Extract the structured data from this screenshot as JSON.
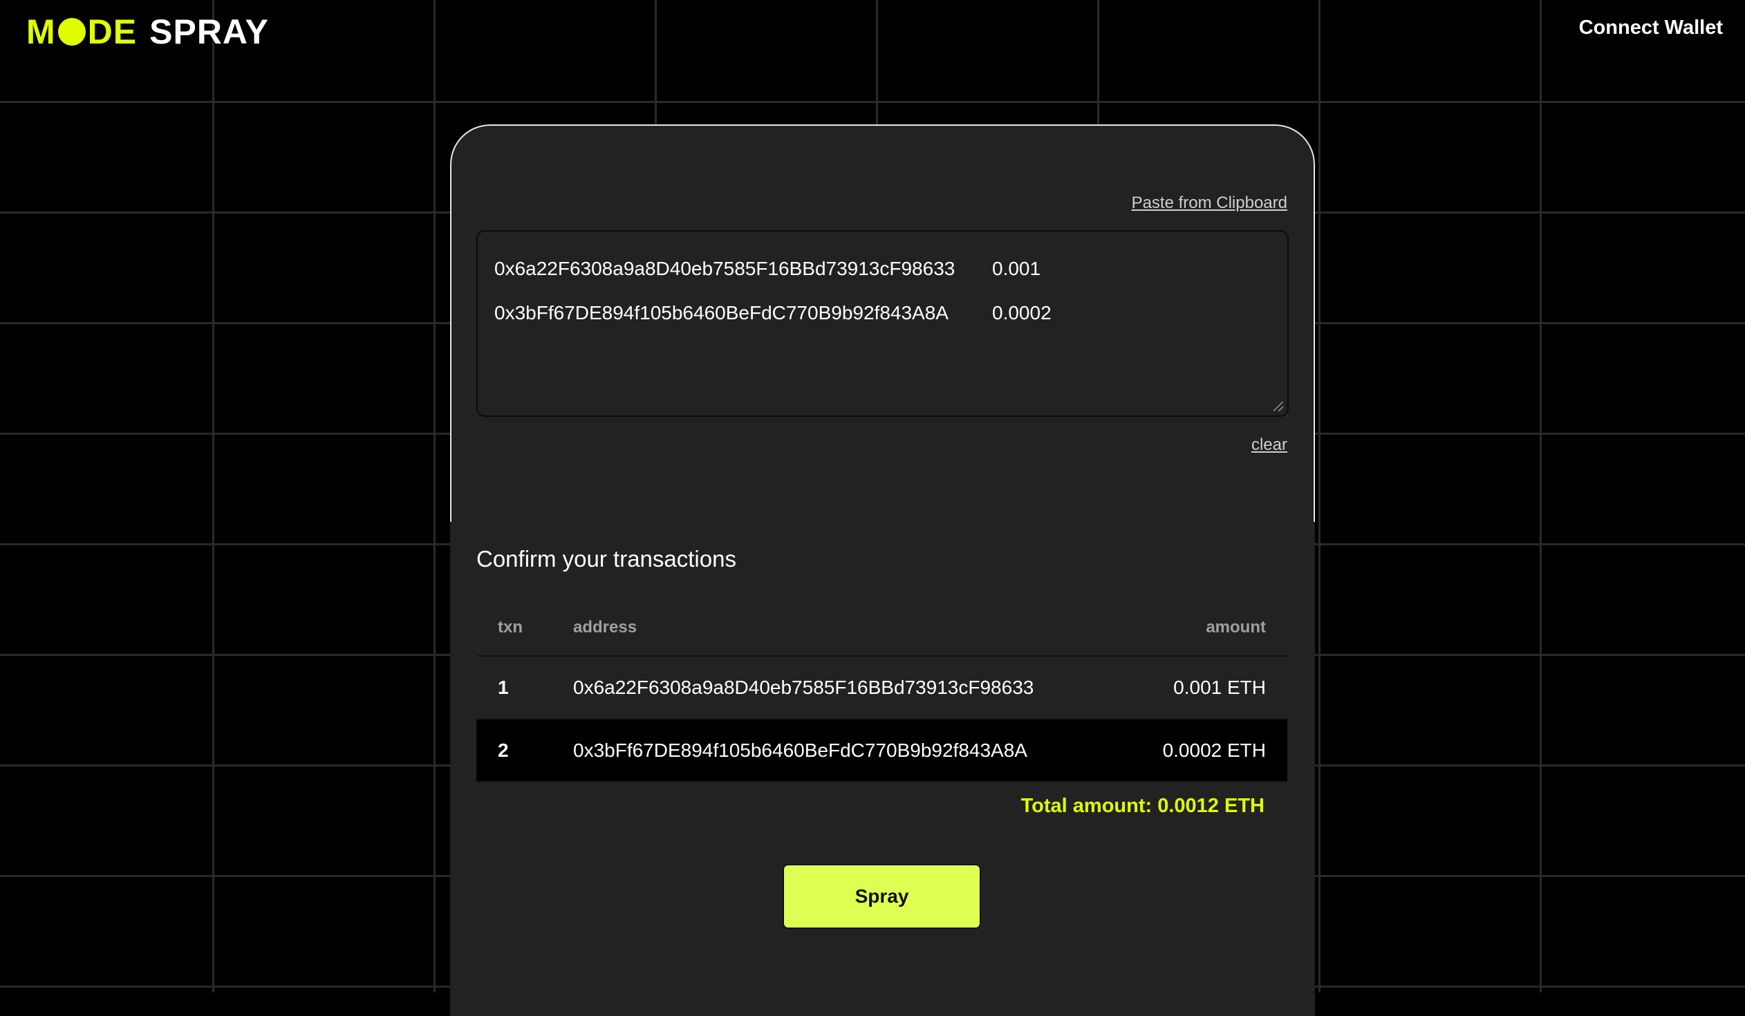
{
  "header": {
    "logo_mode_left": "M",
    "logo_mode_right": "DE",
    "logo_product": "SPRAY",
    "connect_wallet_label": "Connect Wallet"
  },
  "editor": {
    "paste_label": "Paste from Clipboard",
    "lines": [
      {
        "address": "0x6a22F6308a9a8D40eb7585F16BBd73913cF98633",
        "amount": "0.001"
      },
      {
        "address": "0x3bFf67DE894f105b6460BeFdC770B9b92f843A8A",
        "amount": "0.0002"
      }
    ],
    "clear_label": "clear"
  },
  "confirm": {
    "title": "Confirm your transactions",
    "columns": {
      "txn": "txn",
      "address": "address",
      "amount": "amount"
    },
    "rows": [
      {
        "txn": "1",
        "address": "0x6a22F6308a9a8D40eb7585F16BBd73913cF98633",
        "amount": "0.001 ETH"
      },
      {
        "txn": "2",
        "address": "0x3bFf67DE894f105b6460BeFdC770B9b92f843A8A",
        "amount": "0.0002 ETH"
      }
    ],
    "total_label": "Total amount:",
    "total_value": "0.0012 ETH",
    "spray_label": "Spray"
  },
  "colors": {
    "accent": "#dffe00",
    "background": "#000000",
    "card": "#222222"
  }
}
